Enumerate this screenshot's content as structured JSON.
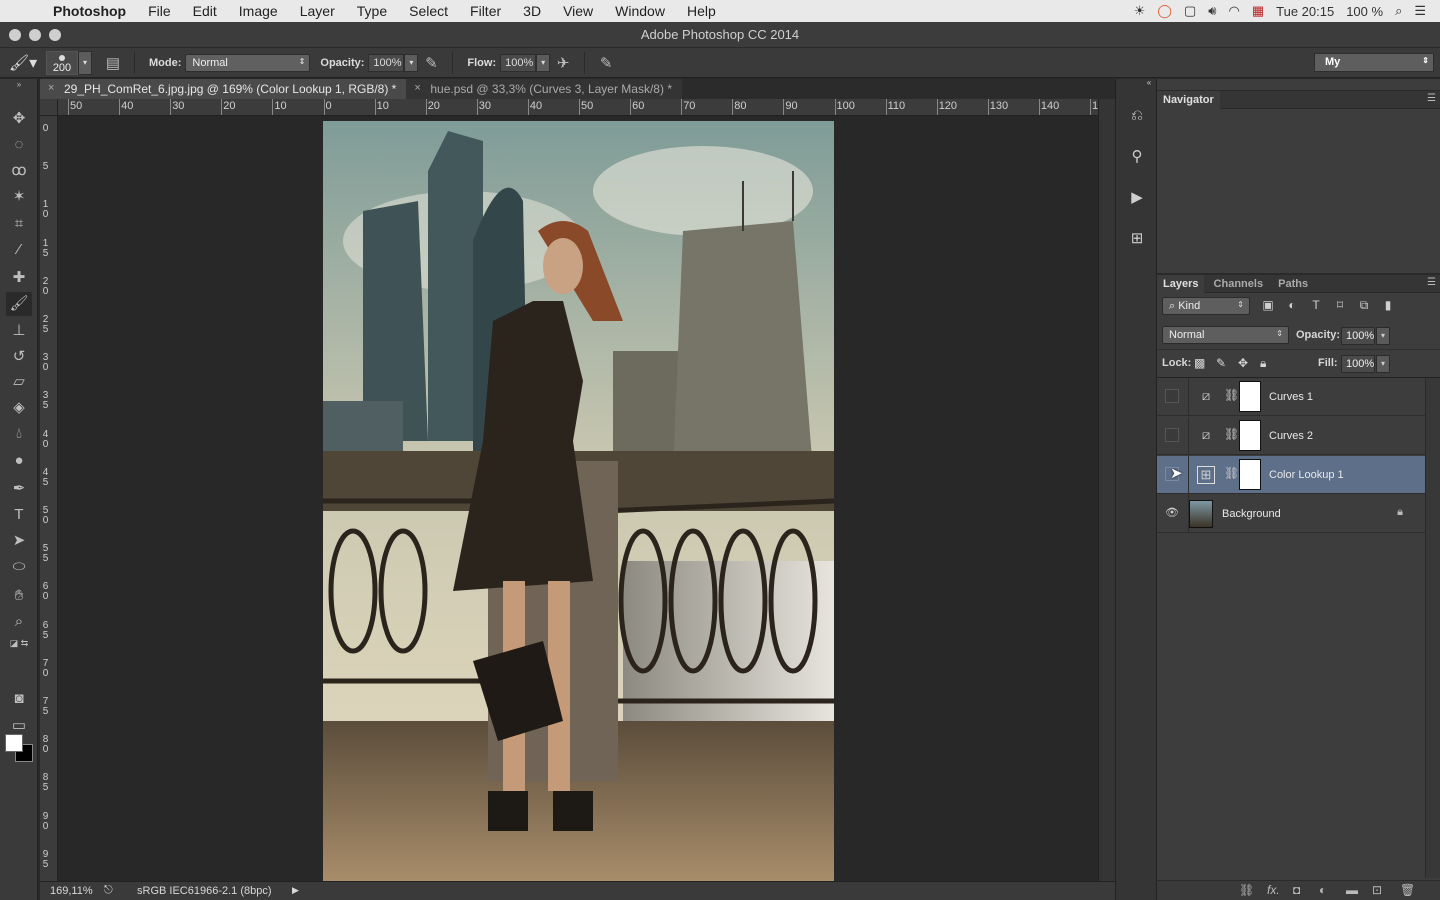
{
  "menubar": {
    "app": "Photoshop",
    "items": [
      "File",
      "Edit",
      "Image",
      "Layer",
      "Type",
      "Select",
      "Filter",
      "3D",
      "View",
      "Window",
      "Help"
    ],
    "clock": "Tue 20:15",
    "battery": "100 %"
  },
  "window": {
    "title": "Adobe Photoshop CC 2014"
  },
  "options": {
    "brush_size": "200",
    "mode_label": "Mode:",
    "mode_value": "Normal",
    "opacity_label": "Opacity:",
    "opacity_value": "100%",
    "flow_label": "Flow:",
    "flow_value": "100%",
    "workspace": "My"
  },
  "doc_tabs": [
    {
      "label": "29_PH_ComRet_6.jpg.jpg @ 169% (Color Lookup 1, RGB/8) *"
    },
    {
      "label": "hue.psd @ 33,3% (Curves 3, Layer Mask/8) *"
    }
  ],
  "hruler_labels": [
    "50",
    "40",
    "30",
    "20",
    "10",
    "0",
    "10",
    "20",
    "30",
    "40",
    "50",
    "60",
    "70",
    "80",
    "90",
    "100",
    "110",
    "120",
    "130",
    "140",
    "1"
  ],
  "vruler_labels": [
    "0",
    "5",
    "10",
    "15",
    "20",
    "25",
    "30",
    "35",
    "40",
    "45",
    "50",
    "55",
    "60",
    "65",
    "70",
    "75",
    "80",
    "85",
    "90",
    "95"
  ],
  "status": {
    "zoom": "169,11%",
    "profile": "sRGB IEC61966-2.1 (8bpc)"
  },
  "navigator": {
    "title": "Navigator"
  },
  "layers_panel": {
    "tabs": [
      "Layers",
      "Channels",
      "Paths"
    ],
    "filter_kind": "Kind",
    "blend_mode": "Normal",
    "opacity_label": "Opacity:",
    "opacity_value": "100%",
    "lock_label": "Lock:",
    "fill_label": "Fill:",
    "fill_value": "100%",
    "layers": [
      {
        "name": "Curves 1",
        "visible": false,
        "selected": false
      },
      {
        "name": "Curves 2",
        "visible": false,
        "selected": false
      },
      {
        "name": "Color Lookup 1",
        "visible": false,
        "selected": true
      },
      {
        "name": "Background",
        "visible": true,
        "selected": false
      }
    ]
  }
}
